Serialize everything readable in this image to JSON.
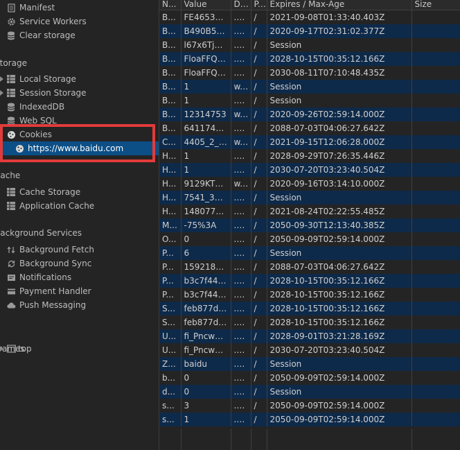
{
  "sidebar": {
    "items": [
      {
        "kind": "item",
        "label": "Manifest",
        "icon": "manifest-icon"
      },
      {
        "kind": "item",
        "label": "Service Workers",
        "icon": "gear-icon"
      },
      {
        "kind": "item",
        "label": "Clear storage",
        "icon": "database-icon"
      },
      {
        "kind": "header",
        "label": "Storage"
      },
      {
        "kind": "expand",
        "label": "Local Storage",
        "icon": "grid-icon"
      },
      {
        "kind": "expand",
        "label": "Session Storage",
        "icon": "grid-icon"
      },
      {
        "kind": "item",
        "label": "IndexedDB",
        "icon": "database-icon"
      },
      {
        "kind": "item",
        "label": "Web SQL",
        "icon": "database-icon"
      },
      {
        "kind": "item",
        "label": "Cookies",
        "icon": "cookie-icon"
      },
      {
        "kind": "child",
        "label": "https://www.baidu.com",
        "icon": "cookie-icon"
      },
      {
        "kind": "header",
        "label": "Cache"
      },
      {
        "kind": "item",
        "label": "Cache Storage",
        "icon": "grid-icon"
      },
      {
        "kind": "item",
        "label": "Application Cache",
        "icon": "grid-icon"
      },
      {
        "kind": "header",
        "label": "Background Services"
      },
      {
        "kind": "item",
        "label": "Background Fetch",
        "icon": "fetch-icon"
      },
      {
        "kind": "item",
        "label": "Background Sync",
        "icon": "sync-icon"
      },
      {
        "kind": "item",
        "label": "Notifications",
        "icon": "notification-icon"
      },
      {
        "kind": "item",
        "label": "Payment Handler",
        "icon": "payment-icon"
      },
      {
        "kind": "item",
        "label": "Push Messaging",
        "icon": "cloud-icon"
      },
      {
        "kind": "header",
        "label": "Frames"
      },
      {
        "kind": "frame",
        "label": "top",
        "icon": "frame-icon"
      }
    ]
  },
  "cookies_table": {
    "columns": [
      "Name",
      "Value",
      "Domain",
      "Path",
      "Expires / Max-Age",
      "Size"
    ],
    "rows": [
      [
        "B...",
        "FE46531B...",
        ".b...",
        "/",
        "2021-09-08T01:33:40.403Z",
        ""
      ],
      [
        "B...",
        "B490B5EB...",
        ".b...",
        "/",
        "2020-09-17T02:31:02.377Z",
        ""
      ],
      [
        "B...",
        "l67x6TjH...",
        ".b...",
        "/",
        "Session",
        ""
      ],
      [
        "B...",
        "FloaFFQM...",
        ".b...",
        "/",
        "2028-10-15T00:35:12.166Z",
        ""
      ],
      [
        "B...",
        "FloaFFQM...",
        ".b...",
        "/",
        "2030-08-11T07:10:48.435Z",
        ""
      ],
      [
        "B...",
        "1",
        "w...",
        "/",
        "Session",
        ""
      ],
      [
        "B...",
        "1",
        ".b...",
        "/",
        "Session",
        ""
      ],
      [
        "B...",
        "12314753",
        "w...",
        "/",
        "2020-09-26T02:59:14.000Z",
        ""
      ],
      [
        "B...",
        "64117446...",
        ".b...",
        "/",
        "2088-07-03T04:06:27.642Z",
        ""
      ],
      [
        "C...",
        "4405_2_7_...",
        "w...",
        "/",
        "2021-09-15T12:06:28.000Z",
        ""
      ],
      [
        "H...",
        "1",
        ".p...",
        "/",
        "2028-09-29T07:26:35.446Z",
        ""
      ],
      [
        "H...",
        "1",
        ".p...",
        "/",
        "2030-07-20T03:23:40.504Z",
        ""
      ],
      [
        "H...",
        "9129KTB...",
        "w...",
        "/",
        "2020-09-16T03:14:10.000Z",
        ""
      ],
      [
        "H...",
        "7541_326...",
        ".b...",
        "/",
        "Session",
        ""
      ],
      [
        "H...",
        "148077_1...",
        ".b...",
        "/",
        "2021-08-24T02:22:55.485Z",
        ""
      ],
      [
        "M...",
        "-75%3A",
        ".b...",
        "/",
        "2050-09-30T12:13:40.385Z",
        ""
      ],
      [
        "O...",
        "0",
        ".w...",
        "/",
        "2050-09-09T02:59:14.000Z",
        ""
      ],
      [
        "P...",
        "6",
        ".b...",
        "/",
        "Session",
        ""
      ],
      [
        "P...",
        "15921823...",
        ".b...",
        "/",
        "2088-07-03T04:06:27.642Z",
        ""
      ],
      [
        "P...",
        "b3c7f444...",
        ".p...",
        "/",
        "2028-10-15T00:35:12.166Z",
        ""
      ],
      [
        "P...",
        "b3c7f444...",
        ".p...",
        "/",
        "2028-10-15T00:35:12.166Z",
        ""
      ],
      [
        "S...",
        "feb877dd...",
        ".p...",
        "/",
        "2028-10-15T00:35:12.166Z",
        ""
      ],
      [
        "S...",
        "feb877dd...",
        ".p...",
        "/",
        "2028-10-15T00:35:12.166Z",
        ""
      ],
      [
        "U...",
        "fi_Pncwhp...",
        ".p...",
        "/",
        "2028-09-01T03:21:28.169Z",
        ""
      ],
      [
        "U...",
        "fi_Pncwhp...",
        ".p...",
        "/",
        "2030-07-20T03:23:40.504Z",
        ""
      ],
      [
        "Z...",
        "baidu",
        ".b...",
        "/",
        "Session",
        ""
      ],
      [
        "b...",
        "0",
        ".w...",
        "/",
        "2050-09-09T02:59:14.000Z",
        ""
      ],
      [
        "d...",
        "0",
        ".w...",
        "/",
        "Session",
        ""
      ],
      [
        "s...",
        "3",
        ".w...",
        "/",
        "2050-09-09T02:59:14.000Z",
        ""
      ],
      [
        "s...",
        "1",
        ".w...",
        "/",
        "2050-09-09T02:59:14.000Z",
        ""
      ]
    ],
    "header_display": [
      "N...",
      "Value",
      "D...",
      "P...",
      "Expires / Max-Age",
      "Size"
    ]
  },
  "colors": {
    "background": "#242424",
    "selected_row": "#0b4f86",
    "alt_row": "#0e2a4a",
    "highlight_border": "#e23b3b"
  }
}
